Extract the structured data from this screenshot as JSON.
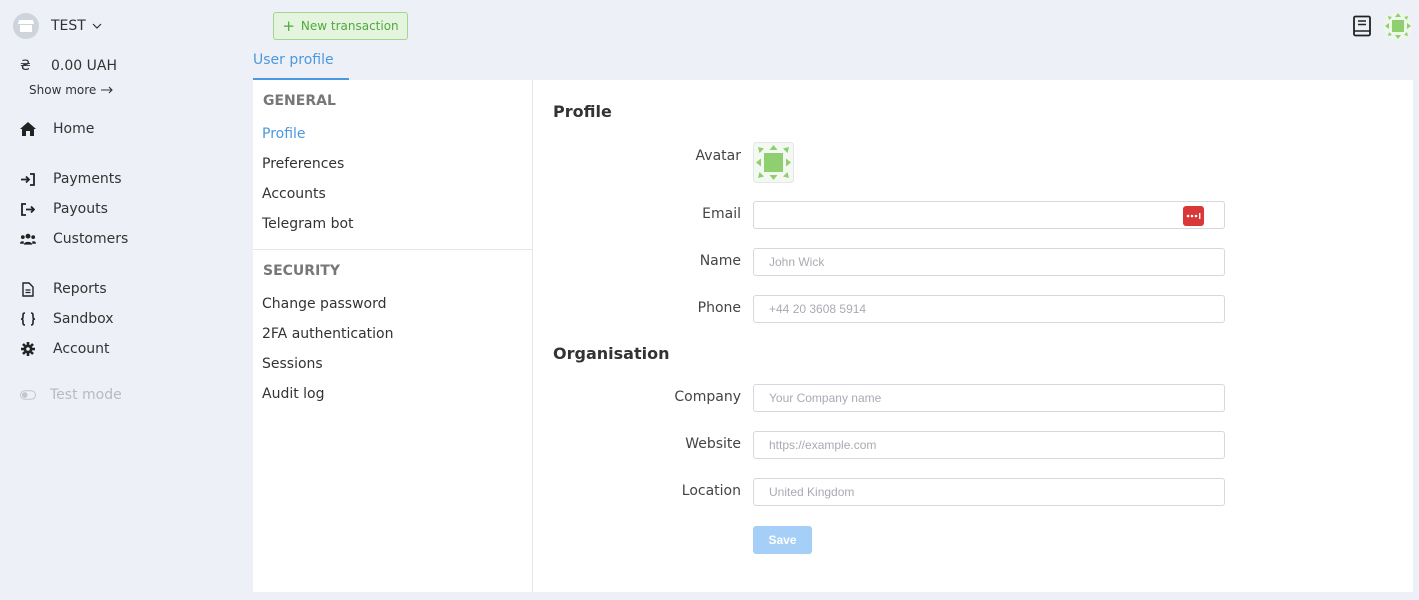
{
  "sidebar": {
    "shop_name": "TEST",
    "balance": {
      "currency_symbol": "₴",
      "amount": "0.00 UAH"
    },
    "show_more": "Show more",
    "nav": [
      {
        "label": "Home",
        "icon": "home-icon"
      },
      {
        "label": "Payments",
        "icon": "payments-icon"
      },
      {
        "label": "Payouts",
        "icon": "payouts-icon"
      },
      {
        "label": "Customers",
        "icon": "customers-icon"
      },
      {
        "label": "Reports",
        "icon": "reports-icon"
      },
      {
        "label": "Sandbox",
        "icon": "sandbox-icon"
      },
      {
        "label": "Account",
        "icon": "gear-icon"
      }
    ],
    "test_mode": "Test mode"
  },
  "topbar": {
    "new_transaction": "New transaction"
  },
  "tabs": [
    {
      "label": "User profile",
      "active": true
    }
  ],
  "settings_nav": {
    "general_title": "GENERAL",
    "general_items": [
      "Profile",
      "Preferences",
      "Accounts",
      "Telegram bot"
    ],
    "security_title": "SECURITY",
    "security_items": [
      "Change password",
      "2FA authentication",
      "Sessions",
      "Audit log"
    ],
    "active_item": "Profile"
  },
  "form": {
    "profile_title": "Profile",
    "avatar_label": "Avatar",
    "email_label": "Email",
    "email_value": "",
    "name_label": "Name",
    "name_placeholder": "John Wick",
    "phone_label": "Phone",
    "phone_placeholder": "+44 20 3608 5914",
    "org_title": "Organisation",
    "company_label": "Company",
    "company_placeholder": "Your Company name",
    "website_label": "Website",
    "website_placeholder": "https://example.com",
    "location_label": "Location",
    "location_placeholder": "United Kingdom",
    "save_label": "Save"
  },
  "colors": {
    "accent": "#4a98e0",
    "green": "#52a93d",
    "save_disabled": "#a6cff7",
    "background": "#edf0f7"
  }
}
